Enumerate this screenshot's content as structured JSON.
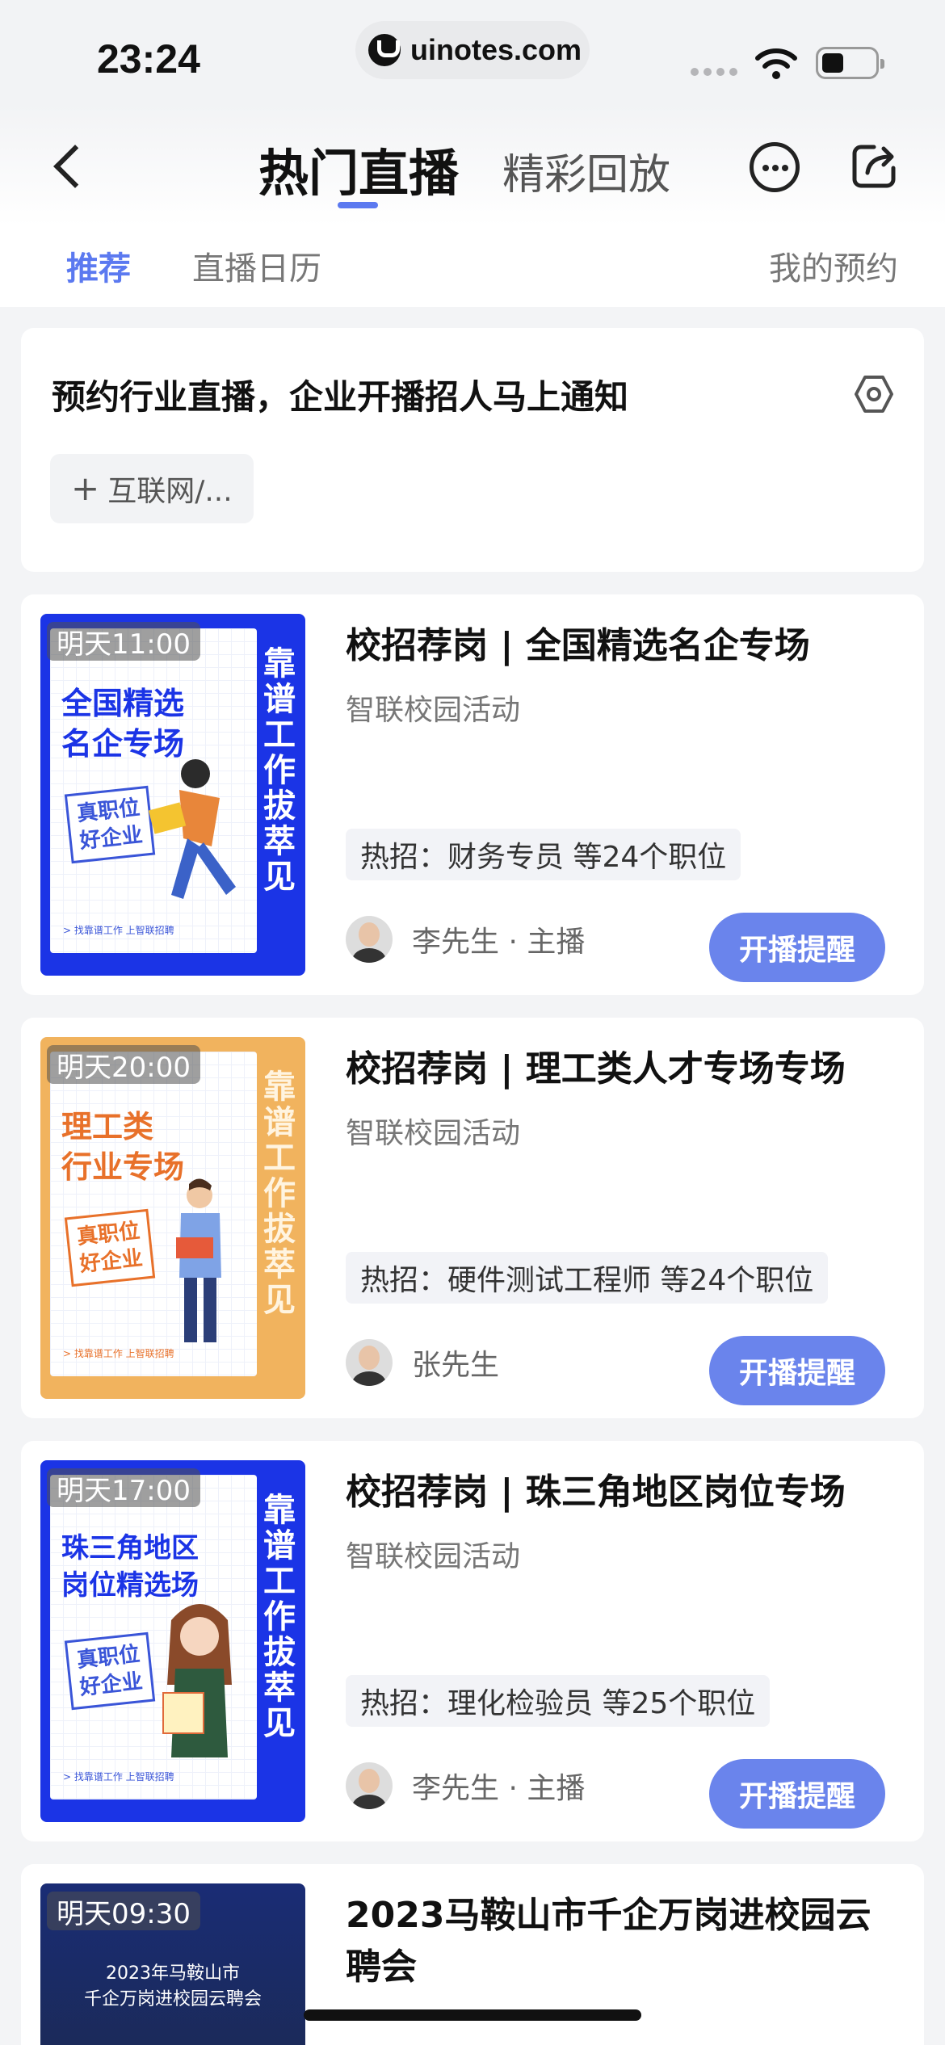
{
  "status_bar": {
    "time": "23:24",
    "url": "uinotes.com"
  },
  "header": {
    "tabs": [
      {
        "label": "热门直播"
      },
      {
        "label": "精彩回放"
      }
    ]
  },
  "subtabs": {
    "items": [
      {
        "label": "推荐"
      },
      {
        "label": "直播日历"
      }
    ],
    "my_booking": "我的预约"
  },
  "subscribe": {
    "title": "预约行业直播，企业开播招人马上通知",
    "chip_label": "互联网/..."
  },
  "lives": [
    {
      "time": "明天11:00",
      "title": "校招荐岗 | 全国精选名企专场",
      "source": "智联校园活动",
      "hot": "热招：财务专员 等24个职位",
      "host": "李先生 · 主播",
      "button": "开播提醒",
      "poster_title": "全国精选\n名企专场",
      "poster_badge": "真职位\n好企业",
      "poster_vertical": "靠谱工作拔萃见",
      "poster_foot": "> 找靠谱工作 上智联招聘"
    },
    {
      "time": "明天20:00",
      "title": "校招荐岗 | 理工类人才专场专场",
      "source": "智联校园活动",
      "hot": "热招：硬件测试工程师 等24个职位",
      "host": "张先生",
      "button": "开播提醒",
      "poster_title": "理工类\n行业专场",
      "poster_badge": "真职位\n好企业",
      "poster_vertical": "靠谱工作拔萃见",
      "poster_foot": "> 找靠谱工作 上智联招聘"
    },
    {
      "time": "明天17:00",
      "title": "校招荐岗 | 珠三角地区岗位专场",
      "source": "智联校园活动",
      "hot": "热招：理化检验员 等25个职位",
      "host": "李先生 · 主播",
      "button": "开播提醒",
      "poster_title": "珠三角地区\n岗位精选场",
      "poster_badge": "真职位\n好企业",
      "poster_vertical": "靠谱工作拔萃见",
      "poster_foot": "> 找靠谱工作 上智联招聘"
    },
    {
      "time": "明天09:30",
      "title": "2023马鞍山市千企万岗进校园云聘会",
      "poster_title": "2023年马鞍山市\n千企万岗进校园云聘会"
    }
  ],
  "colors": {
    "accent": "#5b79f0",
    "button": "#6a84ec",
    "poster_blue": "#1b34e6",
    "poster_orange": "#f1b35e"
  }
}
